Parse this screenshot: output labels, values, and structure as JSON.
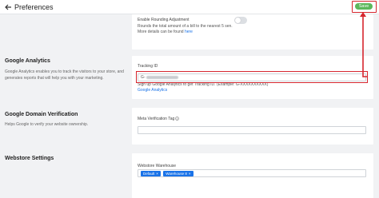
{
  "header": {
    "title": "Preferences",
    "save_label": "Save"
  },
  "rounding": {
    "toggle_label": "Enable Rounding Adjustment",
    "help_line1": "Rounds the total amount of a bill to the nearest 5 sen.",
    "help_line2_prefix": "More details can be found ",
    "help_link": "here"
  },
  "google_analytics": {
    "title": "Google Analytics",
    "description": "Google Analytics enables you to track the visitors to your store, and generates reports that will help you with your marketing.",
    "field_label": "Tracking ID",
    "field_value": "G-",
    "help_text": "Sign up Google Analytics to get Tracking ID. (Example: G-XXXXXXXXXX)",
    "help_link": "Google Analytics"
  },
  "domain_verification": {
    "title": "Google Domain Verification",
    "description": "Helps Google to verify your website ownership.",
    "field_label": "Meta Verification Tag"
  },
  "webstore": {
    "title": "Webstore Settings",
    "field_label": "Webstore Warehouse",
    "chips": [
      "Default",
      "Warehouse 8"
    ],
    "chip_close": "×"
  },
  "colors": {
    "save_green": "#5cb85c",
    "annotation_red": "#d6262e",
    "link_blue": "#1a73e8"
  }
}
